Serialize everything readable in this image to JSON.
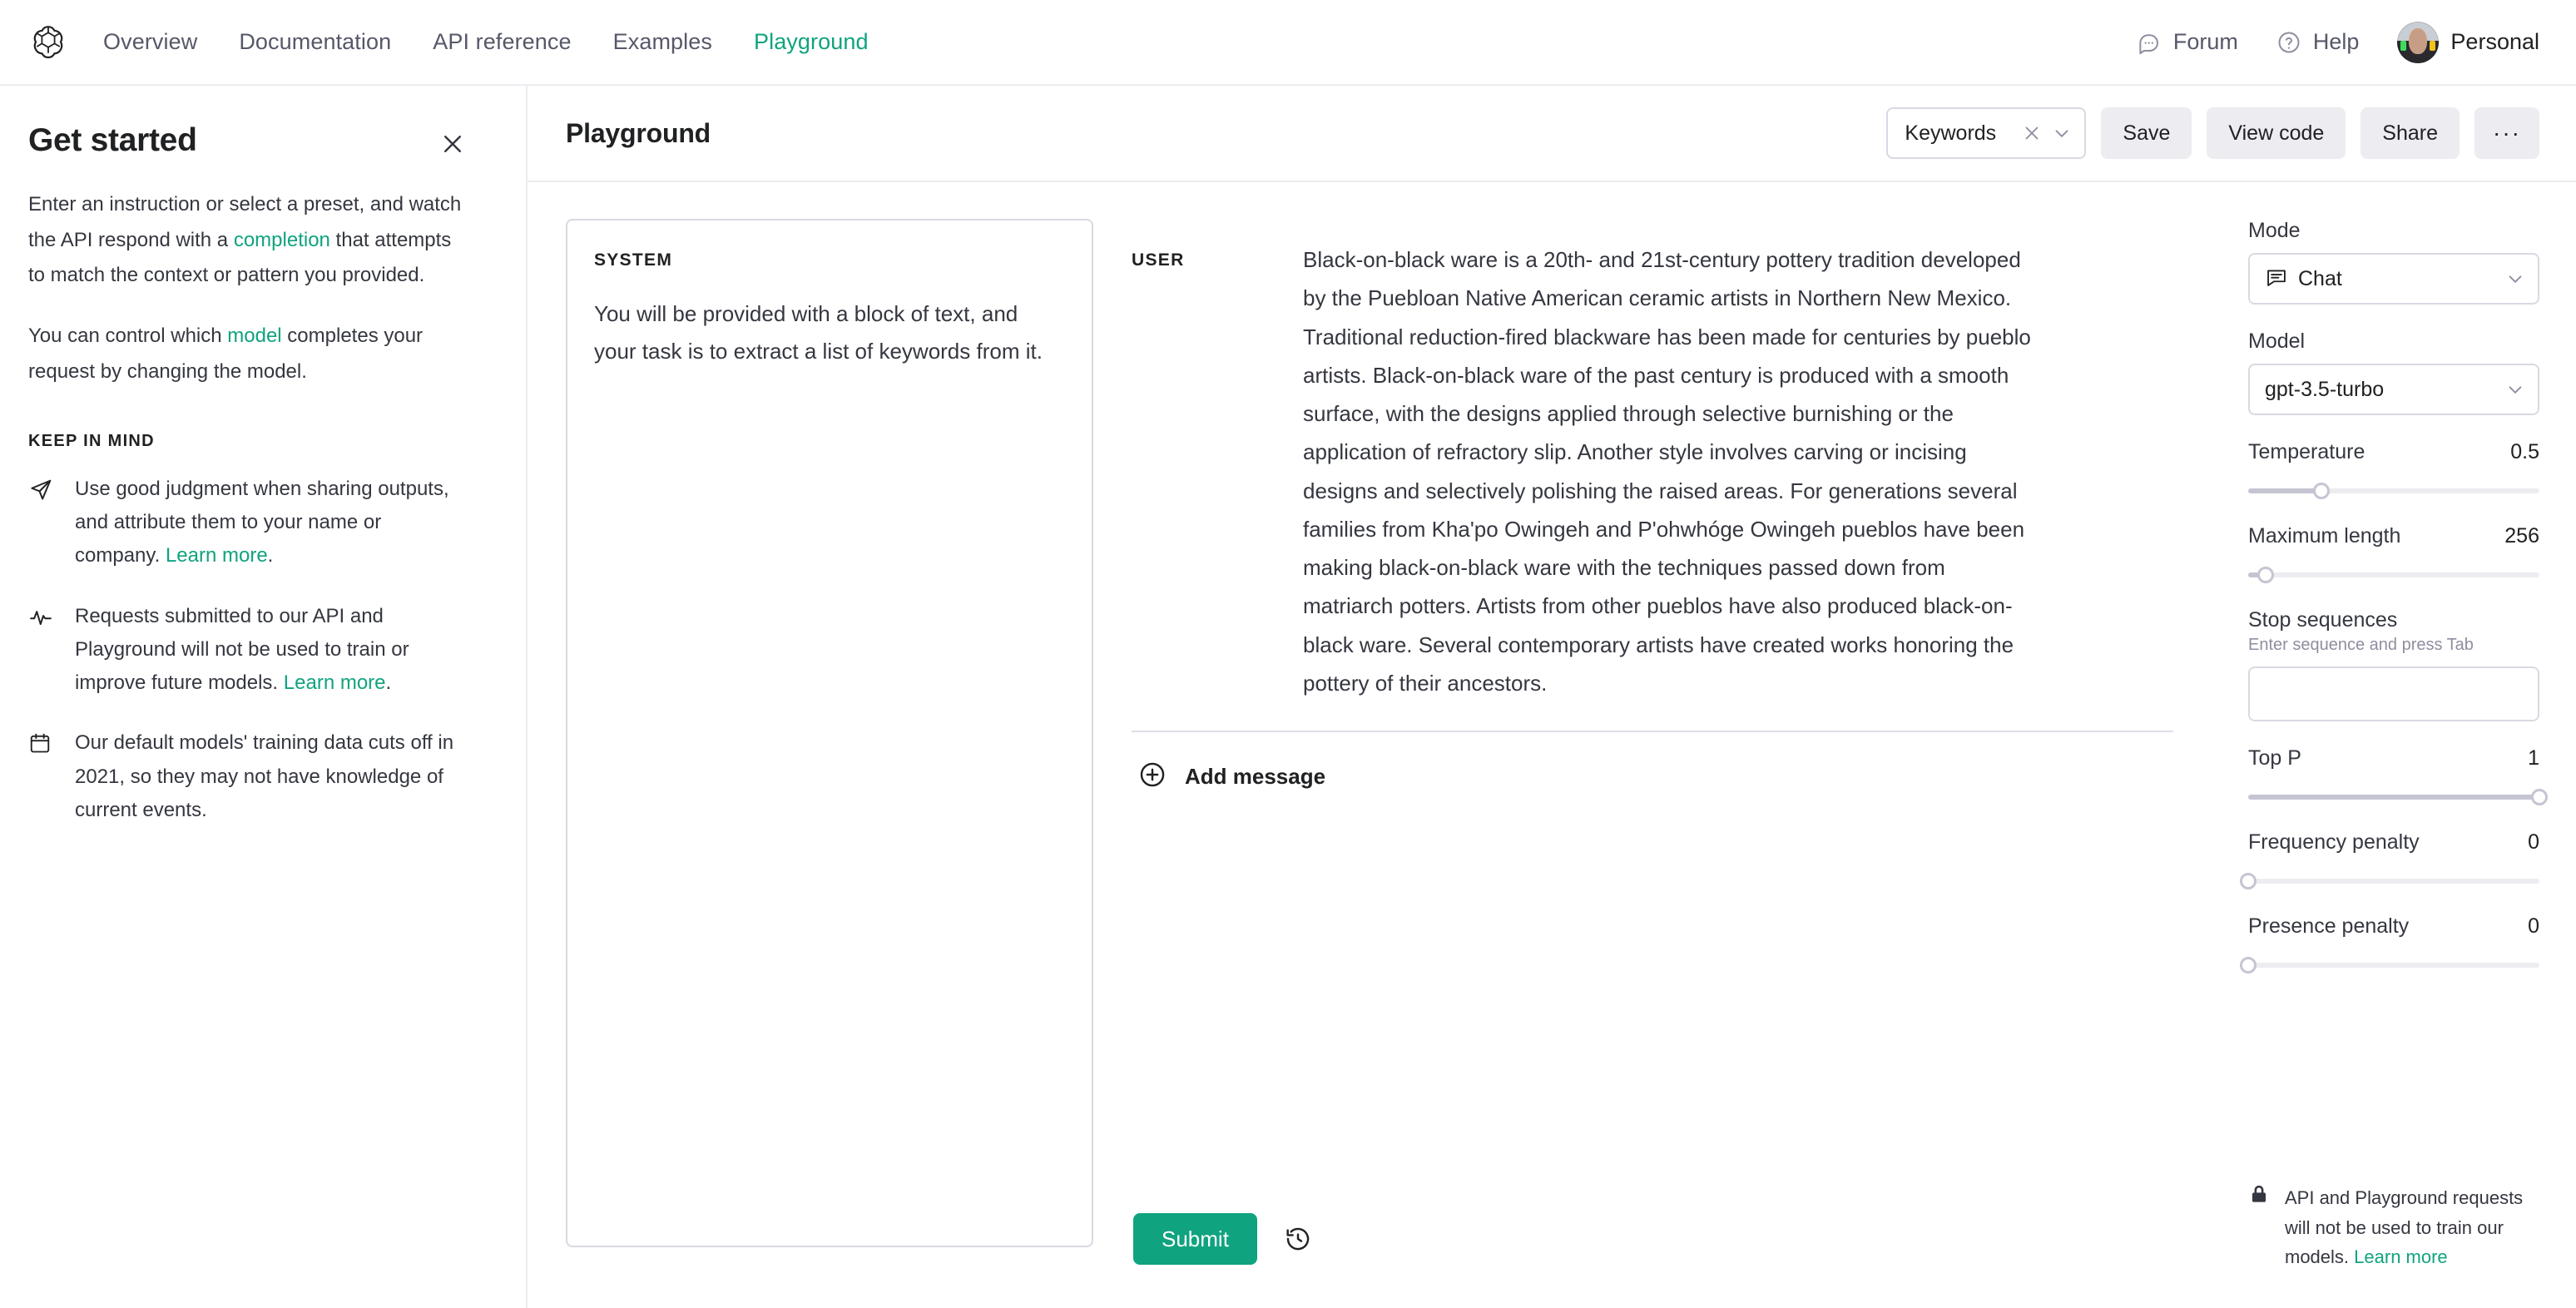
{
  "nav": {
    "logo_icon": "openai-logo",
    "links": [
      {
        "label": "Overview",
        "active": false
      },
      {
        "label": "Documentation",
        "active": false
      },
      {
        "label": "API reference",
        "active": false
      },
      {
        "label": "Examples",
        "active": false
      },
      {
        "label": "Playground",
        "active": true
      }
    ],
    "forum_label": "Forum",
    "forum_icon": "chat-bubble-icon",
    "help_label": "Help",
    "help_icon": "question-circle-icon",
    "account_label": "Personal",
    "account_avatar": "user-avatar"
  },
  "sidebar": {
    "title": "Get started",
    "close_icon": "close-icon",
    "paragraph1_a": "Enter an instruction or select a preset, and watch the API respond with a ",
    "paragraph1_link": "completion",
    "paragraph1_b": " that attempts to match the context or pattern you provided.",
    "paragraph2_a": "You can control which ",
    "paragraph2_link": "model",
    "paragraph2_b": " completes your request by changing the model.",
    "keep_in_mind_label": "KEEP IN MIND",
    "tips": [
      {
        "icon": "send-icon",
        "text_a": "Use good judgment when sharing outputs, and attribute them to your name or company. ",
        "link": "Learn more",
        "text_b": "."
      },
      {
        "icon": "activity-icon",
        "text_a": "Requests submitted to our API and Playground will not be used to train or improve future models. ",
        "link": "Learn more",
        "text_b": "."
      },
      {
        "icon": "calendar-icon",
        "text_a": "Our default models' training data cuts off in 2021, so they may not have knowledge of current events.",
        "link": "",
        "text_b": ""
      }
    ]
  },
  "toolbar": {
    "page_title": "Playground",
    "preset_value": "Keywords",
    "preset_clear_icon": "clear-icon",
    "preset_chevron_icon": "chevron-down-icon",
    "save_label": "Save",
    "view_code_label": "View code",
    "share_label": "Share",
    "more_label": "···"
  },
  "playground": {
    "system_label": "SYSTEM",
    "system_text": "You will be provided with a block of text, and your task is to extract a list of keywords from it.",
    "user_label": "USER",
    "user_text": "Black-on-black ware is a 20th- and 21st-century pottery tradition developed by the Puebloan Native American ceramic artists in Northern New Mexico. Traditional reduction-fired blackware has been made for centuries by pueblo artists. Black-on-black ware of the past century is produced with a smooth surface, with the designs applied through selective burnishing or the application of refractory slip. Another style involves carving or incising designs and selectively polishing the raised areas. For generations several families from Kha'po Owingeh and P'ohwhóge Owingeh pueblos have been making black-on-black ware with the techniques passed down from matriarch potters. Artists from other pueblos have also produced black-on-black ware. Several contemporary artists have created works honoring the pottery of their ancestors.",
    "add_message_label": "Add message",
    "add_message_icon": "plus-circle-icon",
    "submit_label": "Submit",
    "history_icon": "history-icon"
  },
  "params": {
    "mode_label": "Mode",
    "mode_value": "Chat",
    "mode_icon": "chat-mode-icon",
    "model_label": "Model",
    "model_value": "gpt-3.5-turbo",
    "temperature_label": "Temperature",
    "temperature_value": "0.5",
    "temperature_pct": 25,
    "max_length_label": "Maximum length",
    "max_length_value": "256",
    "max_length_pct": 6,
    "stop_label": "Stop sequences",
    "stop_hint": "Enter sequence and press Tab",
    "stop_value": "",
    "top_p_label": "Top P",
    "top_p_value": "1",
    "top_p_pct": 100,
    "frequency_label": "Frequency penalty",
    "frequency_value": "0",
    "frequency_pct": 0,
    "presence_label": "Presence penalty",
    "presence_value": "0",
    "presence_pct": 0,
    "privacy_icon": "lock-icon",
    "privacy_text_a": "API and Playground requests will not be used to train our models. ",
    "privacy_link": "Learn more"
  },
  "colors": {
    "accent_green": "#10a37f",
    "border": "#d9d9e3",
    "chip_bg": "#ececf1",
    "text": "#353740"
  }
}
